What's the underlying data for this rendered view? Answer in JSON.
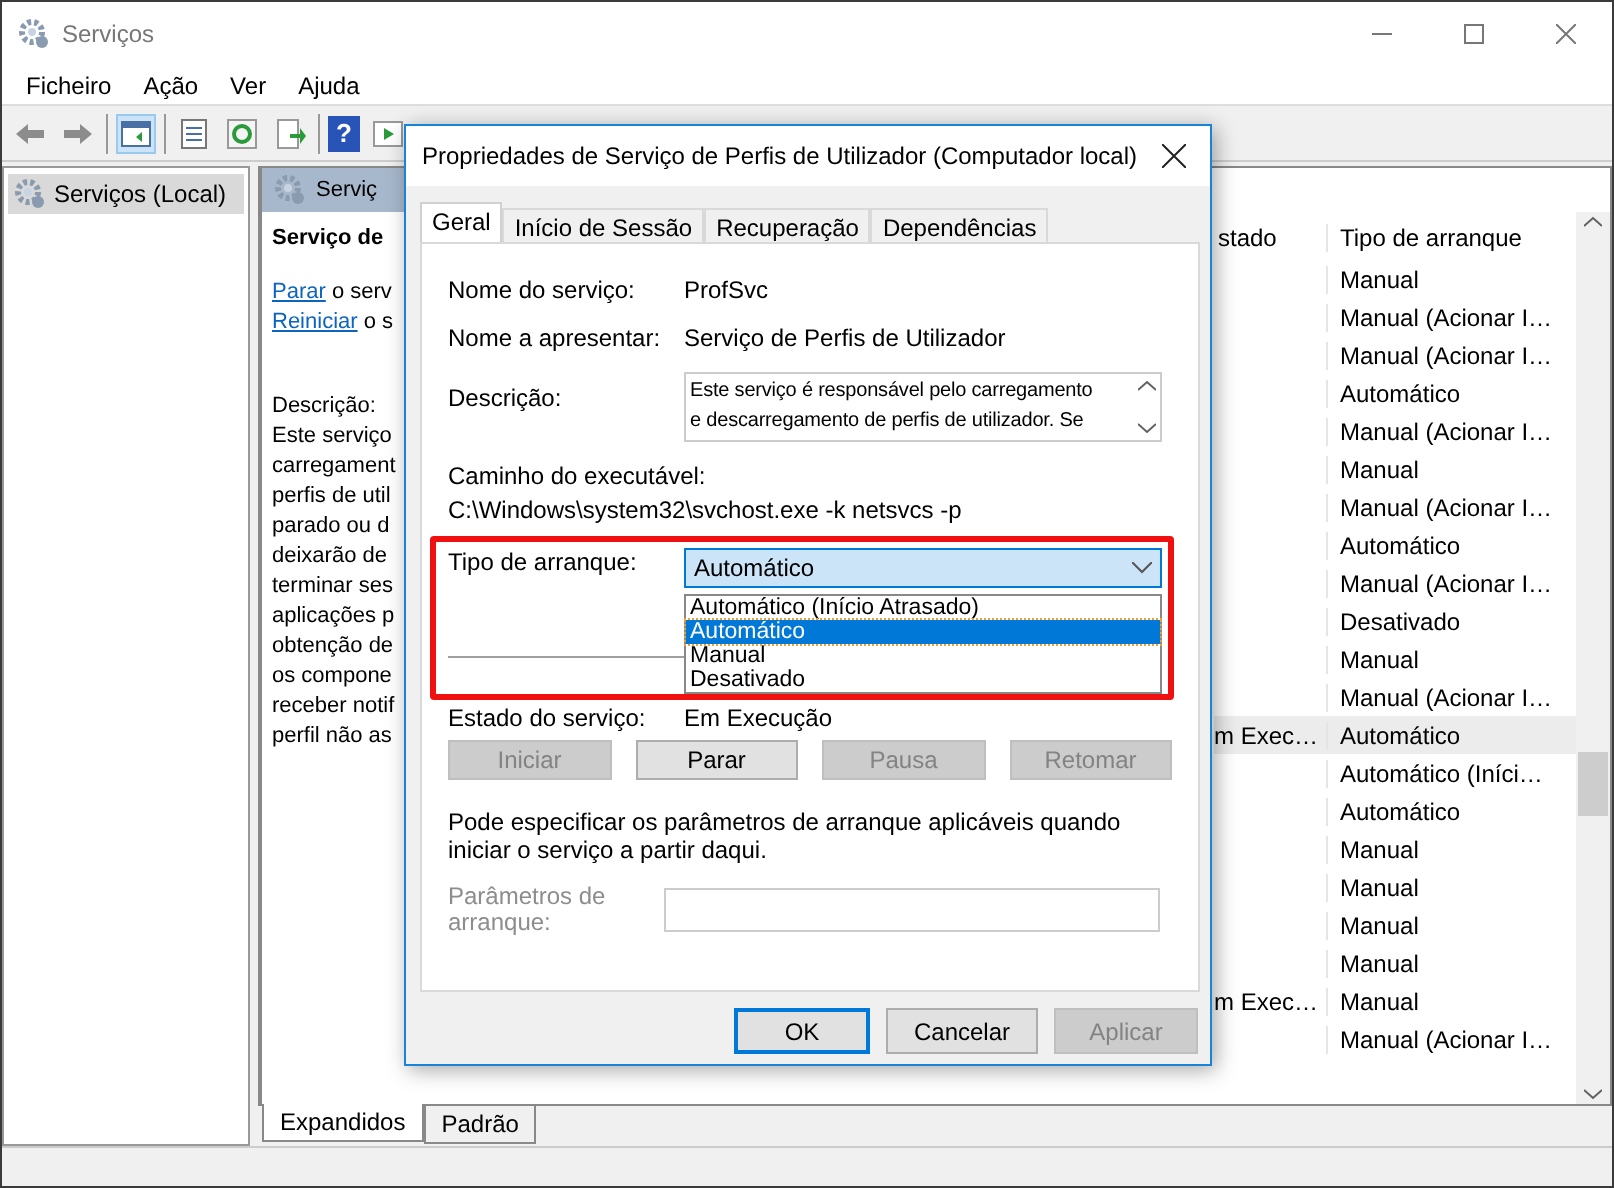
{
  "window": {
    "title": "Serviços"
  },
  "menu": [
    "Ficheiro",
    "Ação",
    "Ver",
    "Ajuda"
  ],
  "toolbar": {
    "help_glyph": "?"
  },
  "tree": [
    {
      "label": "Serviços (Local)",
      "selected": true
    }
  ],
  "detail": {
    "header": "Serviç",
    "title": "Serviço de",
    "links": [
      {
        "text": "Parar",
        "rest": "o serv"
      },
      {
        "text": "Reiniciar",
        "rest": "o s"
      }
    ],
    "description_label": "Descrição:",
    "description_lines": [
      "Este serviço",
      "carregament",
      "perfis de util",
      "parado ou d",
      "deixarão de",
      "terminar ses",
      "aplicações p",
      "obtenção de",
      "os compone",
      "receber notif",
      "perfil não as"
    ]
  },
  "table": {
    "columns": [
      "stado",
      "Tipo de arranque"
    ],
    "rows": [
      {
        "status": "",
        "type": "Manual",
        "selected": false
      },
      {
        "status": "",
        "type": "Manual (Acionar I…",
        "selected": false
      },
      {
        "status": "",
        "type": "Manual (Acionar I…",
        "selected": false
      },
      {
        "status": "",
        "type": "Automático",
        "selected": false
      },
      {
        "status": "",
        "type": "Manual (Acionar I…",
        "selected": false
      },
      {
        "status": "",
        "type": "Manual",
        "selected": false
      },
      {
        "status": "",
        "type": "Manual (Acionar I…",
        "selected": false
      },
      {
        "status": "",
        "type": "Automático",
        "selected": false
      },
      {
        "status": "",
        "type": "Manual (Acionar I…",
        "selected": false
      },
      {
        "status": "",
        "type": "Desativado",
        "selected": false
      },
      {
        "status": "",
        "type": "Manual",
        "selected": false
      },
      {
        "status": "",
        "type": "Manual (Acionar I…",
        "selected": false
      },
      {
        "status": "m Exec…",
        "type": "Automático",
        "selected": true
      },
      {
        "status": "",
        "type": "Automático (Iníci…",
        "selected": false
      },
      {
        "status": "",
        "type": "Automático",
        "selected": false
      },
      {
        "status": "",
        "type": "Manual",
        "selected": false
      },
      {
        "status": "",
        "type": "Manual",
        "selected": false
      },
      {
        "status": "",
        "type": "Manual",
        "selected": false
      },
      {
        "status": "",
        "type": "Manual",
        "selected": false
      },
      {
        "status": "m Exec…",
        "type": "Manual",
        "selected": false
      },
      {
        "status": "",
        "type": "Manual (Acionar I…",
        "selected": false
      }
    ]
  },
  "bottom_tabs": [
    {
      "label": "Expandidos",
      "selected": true
    },
    {
      "label": "Padrão",
      "selected": false
    }
  ],
  "dialog": {
    "title": "Propriedades de Serviço de Perfis de Utilizador (Computador local)",
    "tabs": [
      {
        "label": "Geral",
        "selected": true
      },
      {
        "label": "Início de Sessão",
        "selected": false
      },
      {
        "label": "Recuperação",
        "selected": false
      },
      {
        "label": "Dependências",
        "selected": false
      }
    ],
    "service_name_label": "Nome do serviço:",
    "service_name": "ProfSvc",
    "display_name_label": "Nome a apresentar:",
    "display_name": "Serviço de Perfis de Utilizador",
    "description_label": "Descrição:",
    "description_lines": [
      "Este serviço é responsável pelo carregamento",
      "e descarregamento de perfis de utilizador. Se"
    ],
    "path_label": "Caminho do executável:",
    "path": "C:\\Windows\\system32\\svchost.exe -k netsvcs -p",
    "startup_label": "Tipo de arranque:",
    "startup_value": "Automático",
    "startup_options": [
      {
        "label": "Automático (Início Atrasado)",
        "selected": false
      },
      {
        "label": "Automático",
        "selected": true
      },
      {
        "label": "Manual",
        "selected": false
      },
      {
        "label": "Desativado",
        "selected": false
      }
    ],
    "status_label": "Estado do serviço:",
    "status": "Em Execução",
    "service_buttons": [
      {
        "label": "Iniciar",
        "disabled": true
      },
      {
        "label": "Parar",
        "disabled": false
      },
      {
        "label": "Pausa",
        "disabled": true
      },
      {
        "label": "Retomar",
        "disabled": true
      }
    ],
    "hint": "Pode especificar os parâmetros de arranque aplicáveis quando iniciar o serviço a partir daqui.",
    "params_label": "Parâmetros de arranque:",
    "params_disabled": true,
    "buttons": [
      {
        "label": "OK",
        "default": true,
        "disabled": false
      },
      {
        "label": "Cancelar",
        "default": false,
        "disabled": false
      },
      {
        "label": "Aplicar",
        "default": false,
        "disabled": true
      }
    ]
  }
}
